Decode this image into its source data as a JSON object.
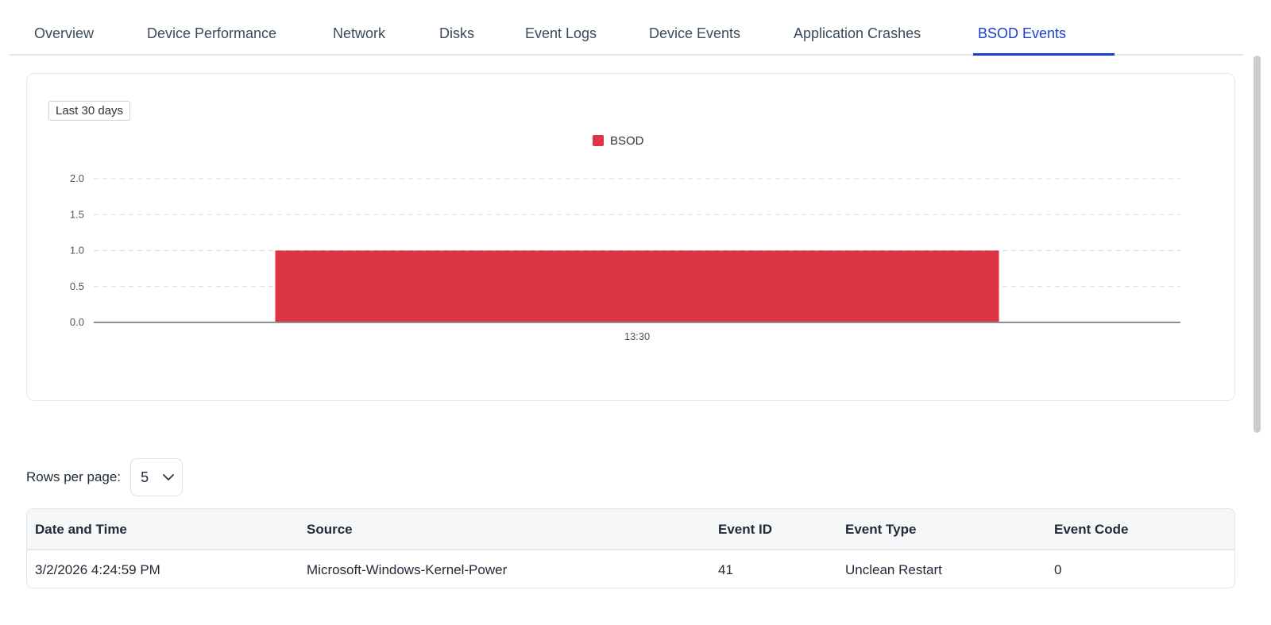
{
  "tabs": [
    {
      "label": "Overview",
      "active": false
    },
    {
      "label": "Device Performance",
      "active": false
    },
    {
      "label": "Network",
      "active": false
    },
    {
      "label": "Disks",
      "active": false
    },
    {
      "label": "Event Logs",
      "active": false
    },
    {
      "label": "Device Events",
      "active": false
    },
    {
      "label": "Application Crashes",
      "active": false
    },
    {
      "label": "BSOD Events",
      "active": true
    }
  ],
  "chart_card": {
    "range_label": "Last 30 days"
  },
  "chart_data": {
    "type": "bar",
    "categories": [
      "13:30"
    ],
    "series": [
      {
        "name": "BSOD",
        "values": [
          1
        ],
        "color": "#dc3545"
      }
    ],
    "yticks": [
      "0.0",
      "0.5",
      "1.0",
      "1.5",
      "2.0"
    ],
    "ylim": [
      0,
      2
    ],
    "grid": true,
    "legend": "top-center"
  },
  "pagination": {
    "rows_per_page_label": "Rows per page:",
    "rows_per_page_value": "5"
  },
  "table": {
    "headers": [
      "Date and Time",
      "Source",
      "Event ID",
      "Event Type",
      "Event Code"
    ],
    "rows": [
      [
        "3/2/2026 4:24:59 PM",
        "Microsoft-Windows-Kernel-Power",
        "41",
        "Unclean Restart",
        "0"
      ]
    ]
  },
  "colors": {
    "accent": "#1a3fcf",
    "bar": "#dc3545"
  }
}
